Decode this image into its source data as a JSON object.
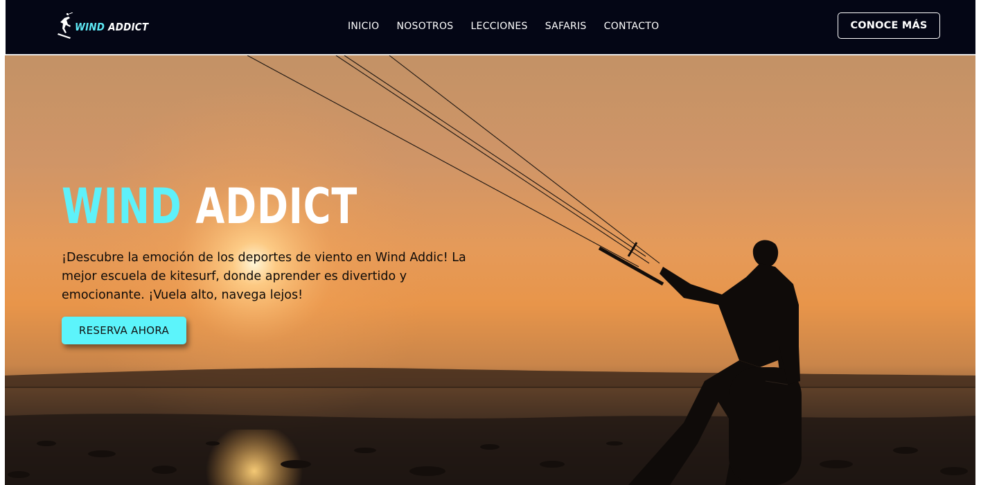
{
  "header": {
    "logo": {
      "icon": "kitesurfer-icon",
      "text_accent": "WIND",
      "text_main": " ADDICT"
    },
    "nav": [
      {
        "label": "INICIO"
      },
      {
        "label": "NOSOTROS"
      },
      {
        "label": "LECCIONES"
      },
      {
        "label": "SAFARIS"
      },
      {
        "label": "CONTACTO"
      }
    ],
    "cta_label": "CONOCE MÁS"
  },
  "hero": {
    "title_accent": "WIND",
    "title_main": "ADDICT",
    "description": "¡Descubre la emoción de los deportes de viento en Wind Addic! La mejor escuela de kitesurf, donde aprender es divertido y emocionante. ¡Vuela alto, navega lejos!",
    "button_label": "RESERVA AHORA",
    "background": "sunset-kitesurfer-photo"
  },
  "colors": {
    "navbar_bg": "#040615",
    "accent_cyan": "#5ef1f9",
    "button_bg": "#5cf4fb",
    "white": "#ffffff"
  }
}
